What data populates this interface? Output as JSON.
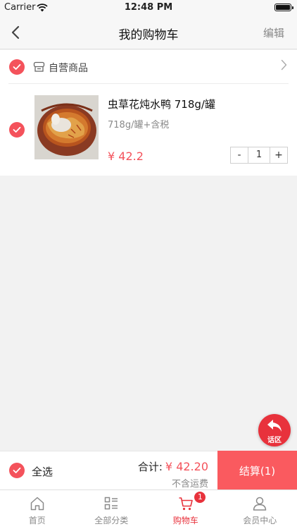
{
  "status_bar": {
    "carrier": "Carrier",
    "time": "12:48 PM"
  },
  "nav": {
    "title": "我的购物车",
    "edit_label": "编辑"
  },
  "store": {
    "name": "自营商品"
  },
  "items": [
    {
      "name": "虫草花炖水鸭 718g/罐",
      "spec": "718g/罐+含税",
      "price": "¥ 42.2",
      "quantity": "1",
      "minus_label": "-",
      "plus_label": "+"
    }
  ],
  "float_button": {
    "label": "话区"
  },
  "checkout": {
    "select_all_label": "全选",
    "total_label": "合计:",
    "total_value": "¥ 42.20",
    "shipping_note": "不含运费",
    "checkout_label": "结算(1)"
  },
  "tabs": [
    {
      "label": "首页",
      "icon": "home-icon"
    },
    {
      "label": "全部分类",
      "icon": "category-list-icon"
    },
    {
      "label": "购物车",
      "icon": "cart-icon",
      "badge": "1",
      "active": true
    },
    {
      "label": "会员中心",
      "icon": "user-icon"
    }
  ],
  "colors": {
    "accent": "#f4525b",
    "checkout_button": "#fa5a5f",
    "active_tab": "#e8323c"
  }
}
